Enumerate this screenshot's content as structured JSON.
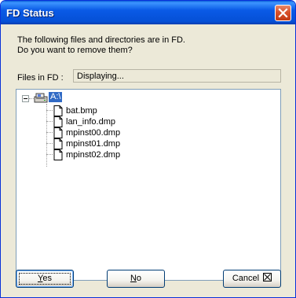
{
  "window": {
    "title": "FD Status",
    "close_icon": "close-icon",
    "accent_color": "#0a5ae6",
    "close_color": "#d8502a"
  },
  "message": {
    "line1": "The following files and directories are in FD.",
    "line2": "Do you want to remove them?"
  },
  "files": {
    "label": "Files in FD :",
    "status": "Displaying..."
  },
  "tree": {
    "root": {
      "label": "A:\\",
      "icon": "floppy-drive-icon",
      "expander": "minus"
    },
    "items": [
      {
        "name": "bat.bmp",
        "icon": "file-icon"
      },
      {
        "name": "lan_info.dmp",
        "icon": "file-icon"
      },
      {
        "name": "mpinst00.dmp",
        "icon": "file-icon"
      },
      {
        "name": "mpinst01.dmp",
        "icon": "file-icon"
      },
      {
        "name": "mpinst02.dmp",
        "icon": "file-icon"
      }
    ],
    "selection_color": "#316ac5"
  },
  "buttons": {
    "yes": {
      "mnemonic": "Y",
      "rest": "es"
    },
    "no": {
      "mnemonic": "N",
      "rest": "o"
    },
    "cancel": {
      "label": "Cancel",
      "glyph": "cancel-box-icon"
    }
  }
}
